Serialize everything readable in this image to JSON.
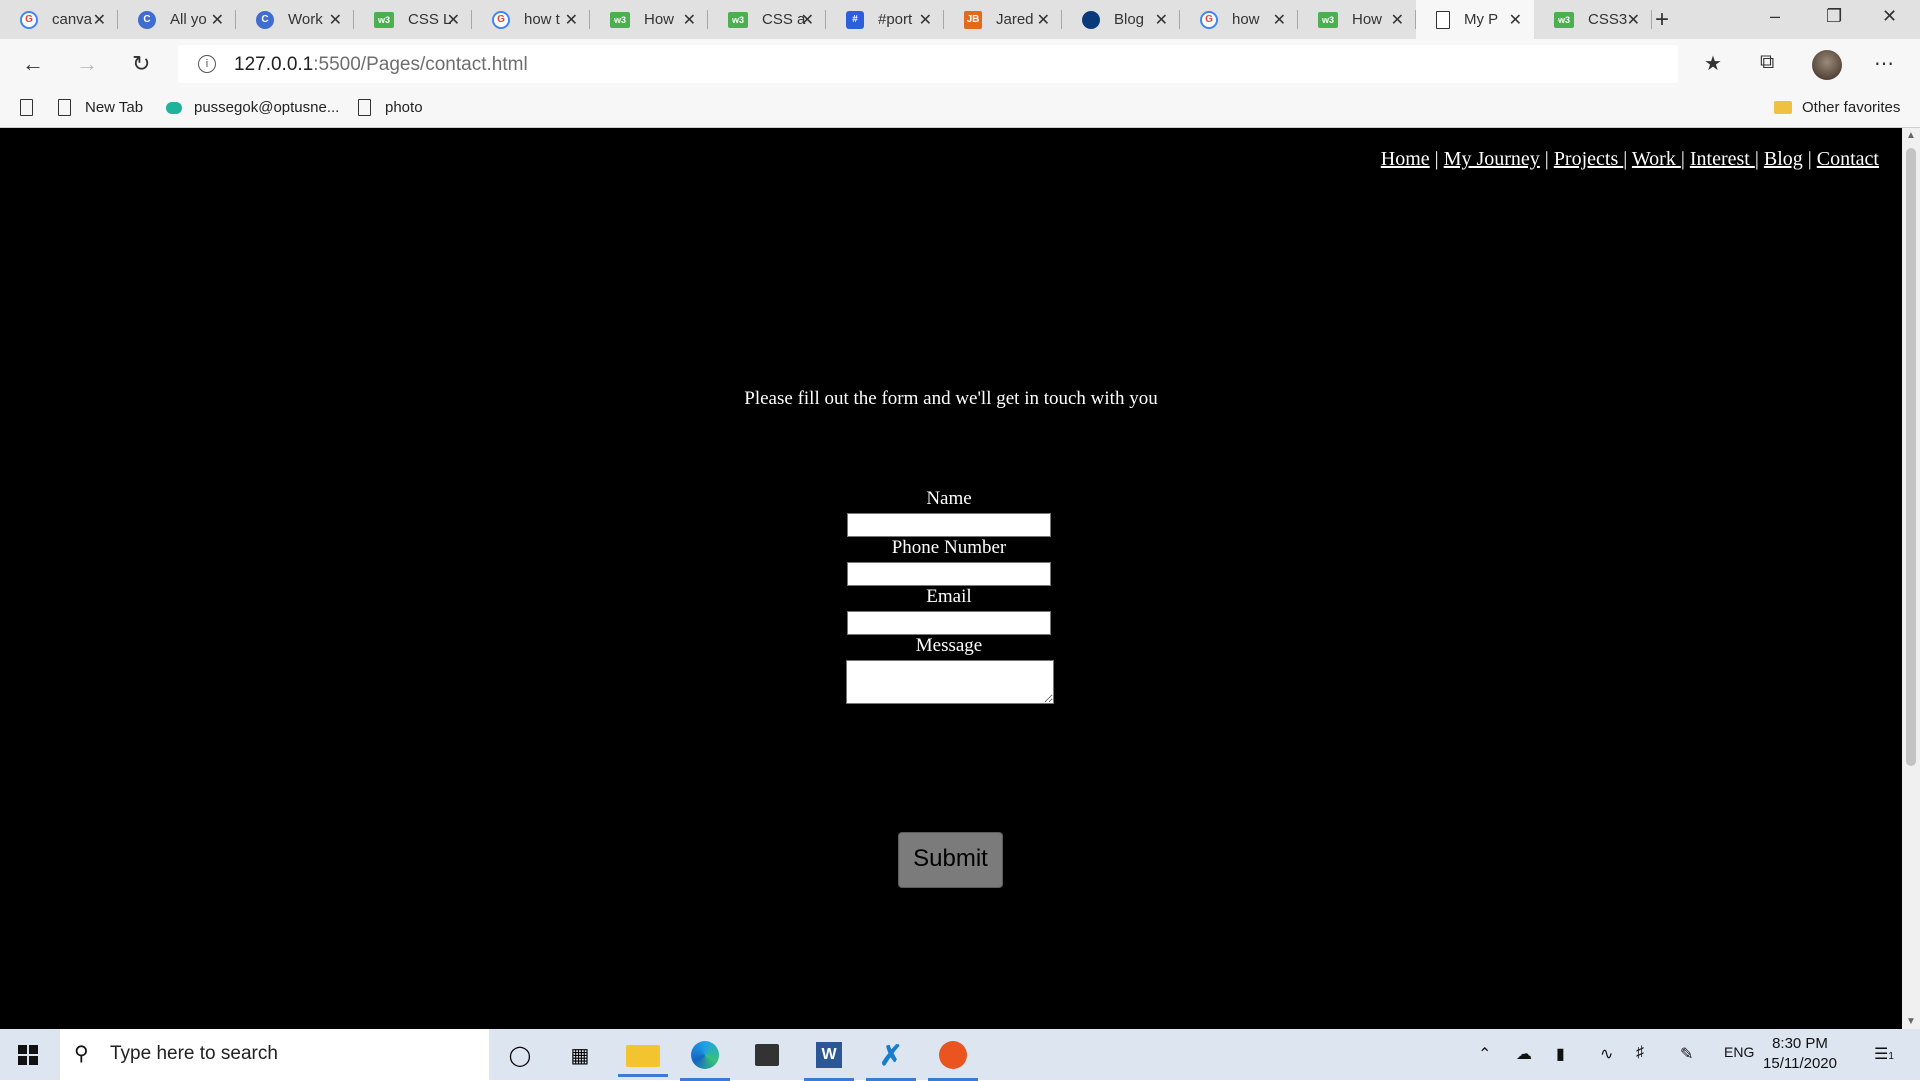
{
  "browser": {
    "tabs": [
      {
        "title": "canva",
        "favicon": "google-icon"
      },
      {
        "title": "All yo",
        "favicon": "c-icon"
      },
      {
        "title": "Work",
        "favicon": "c-icon"
      },
      {
        "title": "CSS L",
        "favicon": "w3schools-icon"
      },
      {
        "title": "how t",
        "favicon": "google-icon"
      },
      {
        "title": "How",
        "favicon": "w3schools-icon"
      },
      {
        "title": "CSS a",
        "favicon": "w3schools-icon"
      },
      {
        "title": "#port",
        "favicon": "hashtag-icon"
      },
      {
        "title": "Jared",
        "favicon": "jb-icon"
      },
      {
        "title": "Blog",
        "favicon": "blog-icon"
      },
      {
        "title": "how",
        "favicon": "google-icon"
      },
      {
        "title": "How",
        "favicon": "w3schools-icon"
      },
      {
        "title": "My P",
        "favicon": "page-icon",
        "active": true
      },
      {
        "title": "CSS3",
        "favicon": "w3schools-icon"
      }
    ],
    "address": {
      "host": "127.0.0.1",
      "path": ":5500/Pages/contact.html"
    },
    "bookmarks": [
      {
        "label": "New Tab",
        "icon": "page-icon"
      },
      {
        "label": "pussegok@optusne...",
        "icon": "optus-icon"
      },
      {
        "label": "photo",
        "icon": "page-icon"
      }
    ],
    "other_favorites": "Other favorites"
  },
  "site": {
    "nav": {
      "home": "Home",
      "journey": "My Journey",
      "projects": "Projects ",
      "work": "Work ",
      "interest": "Interest ",
      "blog": "Blog",
      "contact": "Contact",
      "sep": " | "
    },
    "intro": "Please fill out the form and we'll get in touch with you",
    "form": {
      "name_label": "Name",
      "phone_label": "Phone Number",
      "email_label": "Email",
      "message_label": "Message",
      "submit_label": "Submit"
    }
  },
  "taskbar": {
    "search_placeholder": "Type here to search",
    "language": "ENG",
    "time": "8:30 PM",
    "date": "15/11/2020",
    "notification_count": "1"
  }
}
